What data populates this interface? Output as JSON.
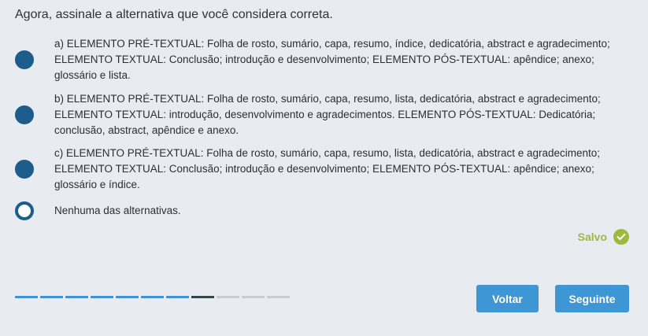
{
  "question": "Agora, assinale a alternativa que você considera correta.",
  "options": [
    {
      "text": "a) ELEMENTO PRÉ-TEXTUAL: Folha de rosto, sumário, capa, resumo, índice, dedicatória, abstract e agradecimento; ELEMENTO TEXTUAL: Conclusão; introdução e desenvolvimento; ELEMENTO PÓS-TEXTUAL: apêndice; anexo; glossário e lista.",
      "selected": false,
      "radio_state": "filled"
    },
    {
      "text": "b) ELEMENTO PRÉ-TEXTUAL: Folha de rosto, sumário, capa, resumo, lista, dedicatória, abstract e agradecimento; ELEMENTO TEXTUAL: introdução, desenvolvimento e agradecimentos. ELEMENTO PÓS-TEXTUAL: Dedicatória; conclusão, abstract, apêndice e anexo.",
      "selected": false,
      "radio_state": "filled"
    },
    {
      "text": "c) ELEMENTO PRÉ-TEXTUAL: Folha de rosto, sumário, capa, resumo, lista, dedicatória, abstract e agradecimento; ELEMENTO TEXTUAL: Conclusão; introdução e desenvolvimento; ELEMENTO PÓS-TEXTUAL: apêndice; anexo; glossário e índice.",
      "selected": false,
      "radio_state": "filled"
    },
    {
      "text": "Nenhuma das alternativas.",
      "selected": true,
      "radio_state": "ring"
    }
  ],
  "status": {
    "label": "Salvo",
    "icon": "check-circle-icon",
    "color": "#9dba3d"
  },
  "progress": {
    "total_steps": 11,
    "current_step": 8,
    "completed_color": "#3f95d3",
    "current_color": "#39434b",
    "pending_color": "#c9cdd1"
  },
  "buttons": {
    "back_label": "Voltar",
    "next_label": "Seguinte",
    "color": "#3f96d4"
  }
}
